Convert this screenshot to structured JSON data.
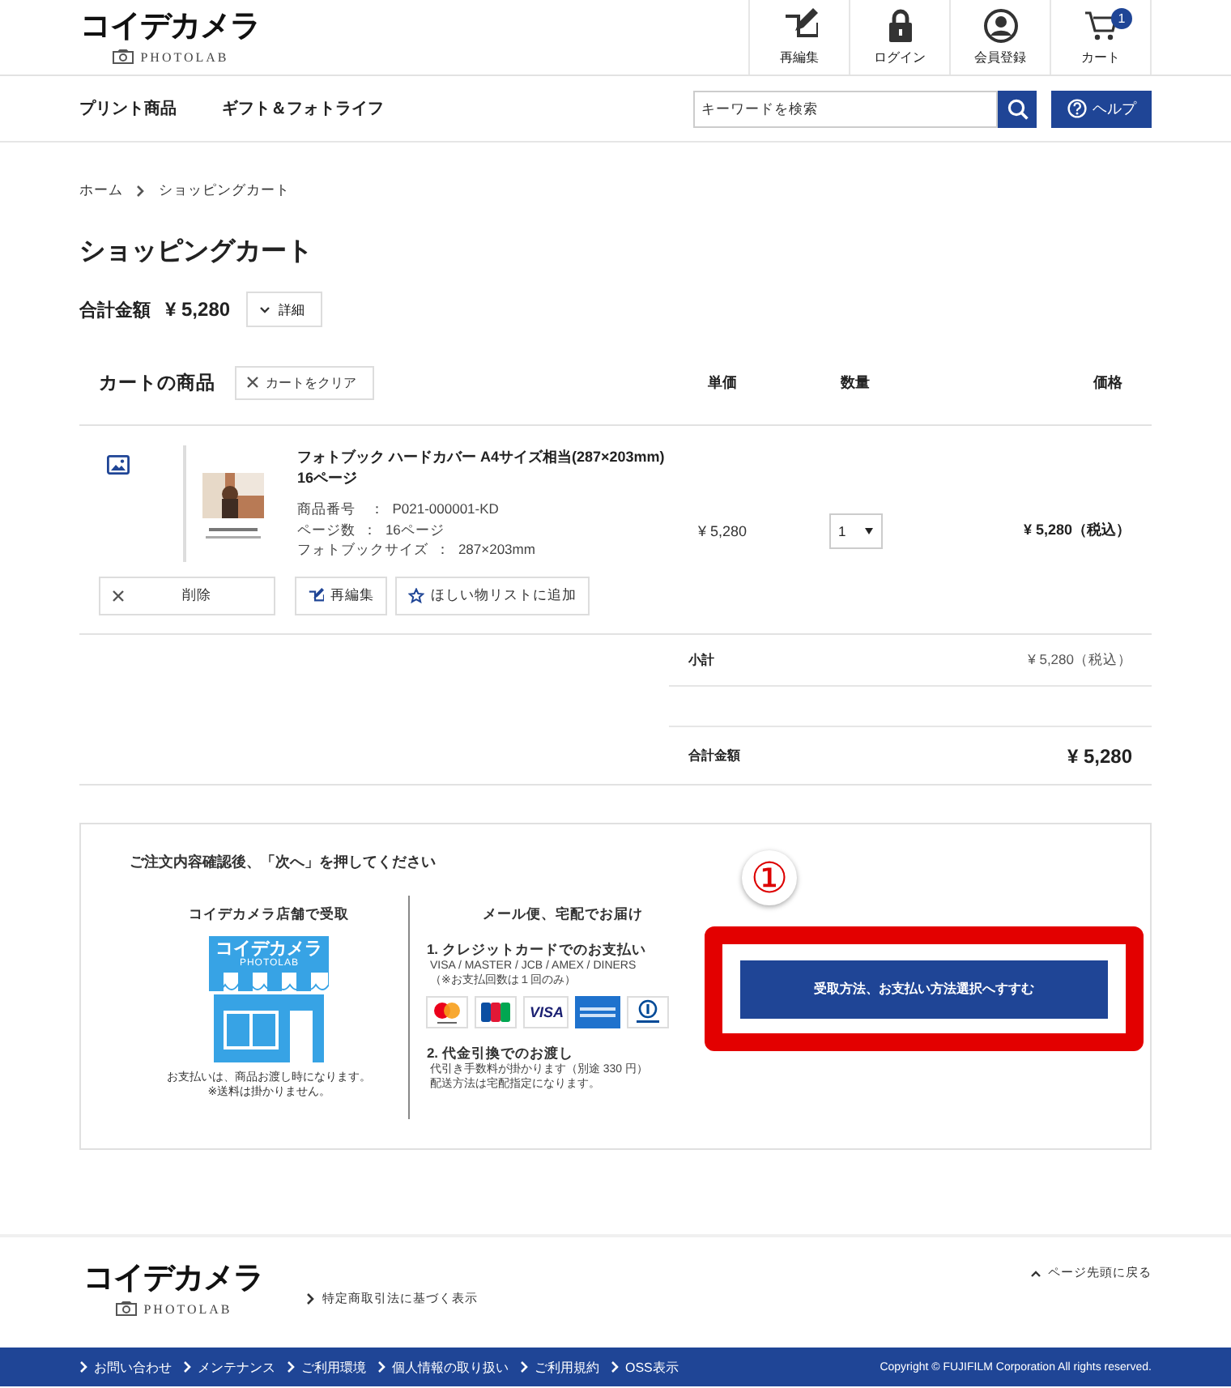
{
  "header": {
    "logo": {
      "name": "コイデカメラ",
      "sub": "PHOTOLAB"
    },
    "icons": [
      {
        "kind": "edit",
        "label": "再編集"
      },
      {
        "kind": "lock",
        "label": "ログイン"
      },
      {
        "kind": "user",
        "label": "会員登録"
      },
      {
        "kind": "cart",
        "label": "カート",
        "badge": "1"
      }
    ]
  },
  "nav": {
    "items": [
      "プリント商品",
      "ギフト＆フォトライフ"
    ],
    "search": {
      "placeholder": "キーワードを検索"
    },
    "help": "ヘルプ"
  },
  "breadcrumb": [
    "ホーム",
    "ショッピングカート"
  ],
  "page_title": "ショッピングカート",
  "summary": {
    "label": "合計金額",
    "amount": "¥ 5,280",
    "details": "詳細"
  },
  "cart": {
    "heading": "カートの商品",
    "clear": "カートをクリア",
    "columns": [
      "単価",
      "数量",
      "価格"
    ],
    "items": [
      {
        "name": "フォトブック ハードカバー A4サイズ相当(287×203mm) 16ページ",
        "specs": [
          "商品番号　：  P021-000001-KD",
          "ページ数  ：  16ページ",
          "フォトブックサイズ  ：  287×203mm"
        ],
        "unit_price": "¥ 5,280",
        "quantity": "1",
        "price": "¥ 5,280（税込）",
        "actions": [
          {
            "kind": "delete",
            "label": "削除"
          },
          {
            "kind": "edit",
            "label": "再編集"
          },
          {
            "kind": "wishlist",
            "label": "ほしい物リストに追加"
          }
        ]
      }
    ],
    "totals": [
      {
        "kind": "subtotal",
        "label": "小計",
        "value": "¥ 5,280（税込）"
      },
      {
        "kind": "spacer"
      },
      {
        "kind": "total",
        "label": "合計金額",
        "value": "¥ 5,280"
      }
    ]
  },
  "checkout": {
    "instruction": "ご注文内容確認後、「次へ」を押してください",
    "store": {
      "heading": "コイデカメラ店舗で受取",
      "sign": "コイデカメラ",
      "sign_sub": "PHOTOLAB",
      "notes": [
        "お支払いは、商品お渡し時になります。",
        "※送料は掛かりません。"
      ]
    },
    "delivery": {
      "heading": "メール便、宅配でお届け",
      "methods": [
        {
          "title": "1. クレジットカードでのお支払い",
          "notes": [
            "VISA / MASTER / JCB / AMEX / DINERS",
            "（※お支払回数は１回のみ）"
          ],
          "cards": [
            {
              "kind": "mastercard"
            },
            {
              "kind": "jcb"
            },
            {
              "kind": "visa",
              "label": "VISA"
            },
            {
              "kind": "amex"
            },
            {
              "kind": "diners"
            }
          ]
        },
        {
          "title": "2. 代金引換でのお渡し",
          "notes": [
            "代引き手数料が掛かります（別途 330 円）",
            "配送方法は宅配指定になります。"
          ]
        }
      ]
    },
    "next_button": "受取方法、お支払い方法選択へすすむ",
    "annotation": "①"
  },
  "footer": {
    "logo": {
      "name": "コイデカメラ",
      "sub": "PHOTOLAB"
    },
    "legal_link": "特定商取引法に基づく表示",
    "back_to_top": "ページ先頭に戻る",
    "links": [
      "お問い合わせ",
      "メンテナンス",
      "ご利用環境",
      "個人情報の取り扱い",
      "ご利用規約",
      "OSS表示"
    ],
    "copyright": "Copyright © FUJIFILM Corporation All rights reserved."
  }
}
